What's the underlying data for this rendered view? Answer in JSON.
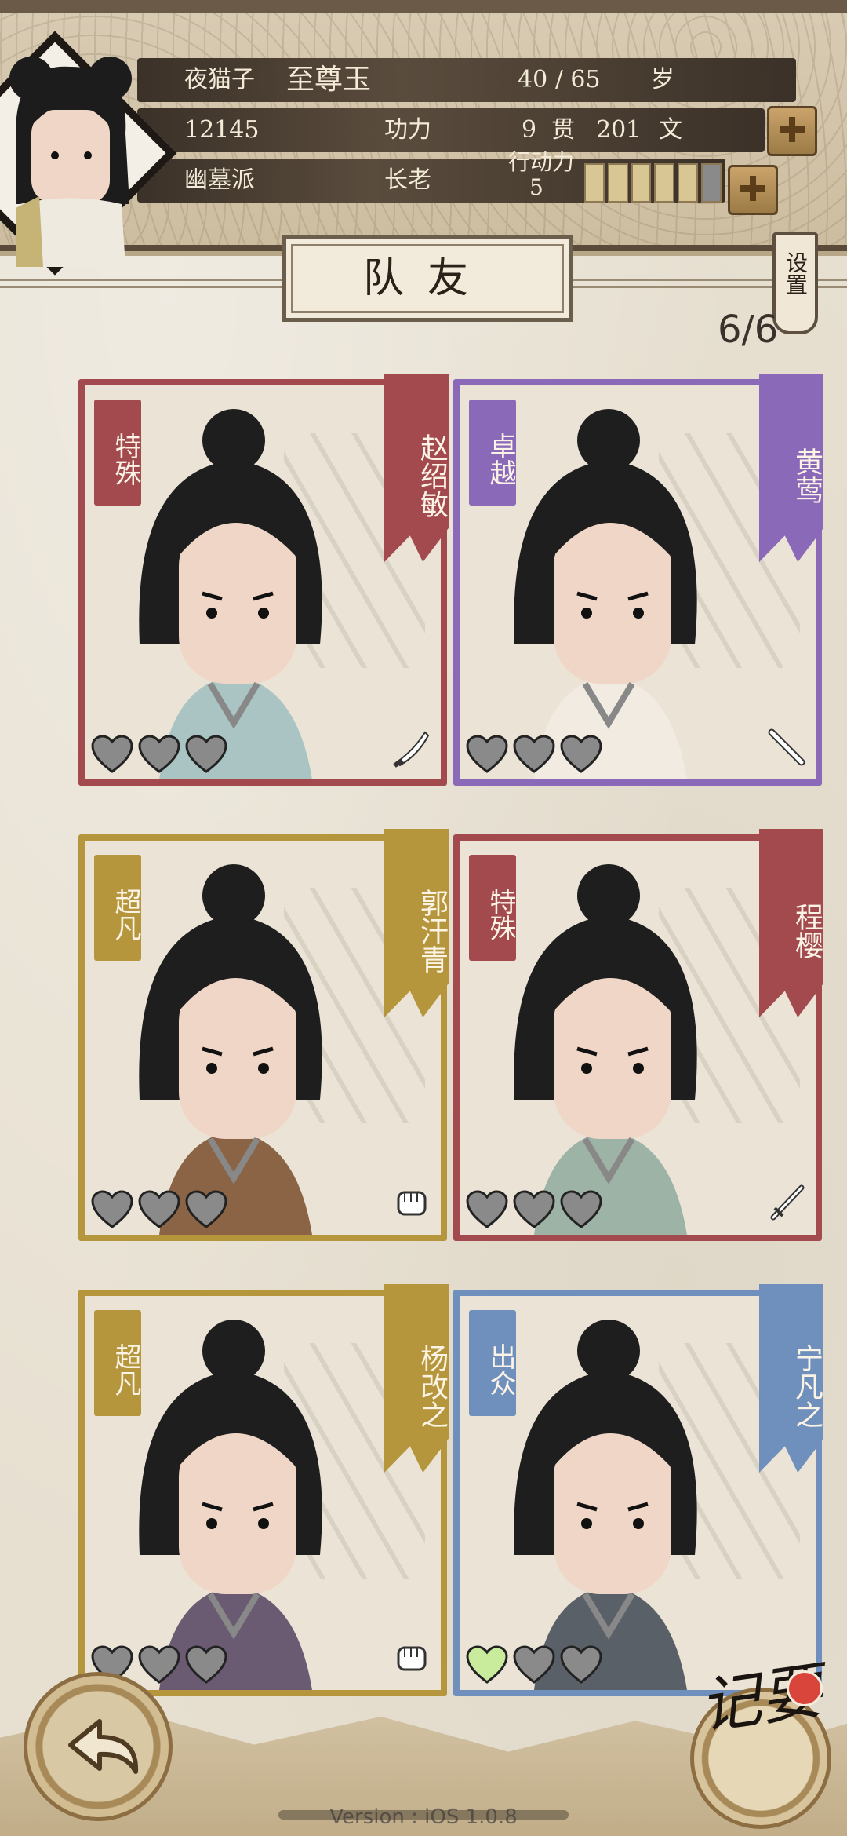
{
  "player": {
    "title": "夜猫子",
    "name": "至尊玉",
    "age": "40 / 65",
    "age_unit": "岁",
    "power_value": "12145",
    "power_label": "功力",
    "money_guan": "9",
    "money_guan_unit": "贯",
    "money_wen": "201",
    "money_wen_unit": "文",
    "sect": "幽墓派",
    "rank": "长老",
    "action_label": "行动力",
    "action_value": "5",
    "stamina_segments_filled": 5,
    "stamina_segments_total": 6
  },
  "header": {
    "title": "队友",
    "settings_label": "设置",
    "team_count": "6/6"
  },
  "colors": {
    "special": "#a24a4e",
    "excellent_gold": "#b6963c",
    "zhuoyue_purple": "#8a6ab8",
    "chuzhong_blue": "#6f90bd",
    "heart_empty": "#8a8a8a",
    "heart_full": "#c9ec9c"
  },
  "teammates": [
    {
      "name": "赵绍敏",
      "rank": "特殊",
      "color": "#a24a4e",
      "hearts_filled": 0,
      "weapon_icon": "saber-icon"
    },
    {
      "name": "黄莺",
      "rank": "卓越",
      "color": "#8a6ab8",
      "hearts_filled": 0,
      "weapon_icon": "flute-icon"
    },
    {
      "name": "郭汗青",
      "rank": "超凡",
      "color": "#b6963c",
      "hearts_filled": 0,
      "weapon_icon": "fist-icon"
    },
    {
      "name": "程樱",
      "rank": "特殊",
      "color": "#a24a4e",
      "hearts_filled": 0,
      "weapon_icon": "sword-icon"
    },
    {
      "name": "杨改之",
      "rank": "超凡",
      "color": "#b6963c",
      "hearts_filled": 0,
      "weapon_icon": "fist-icon"
    },
    {
      "name": "宁凡之",
      "rank": "出众",
      "color": "#6f90bd",
      "hearts_filled": 1,
      "weapon_icon": "none"
    }
  ],
  "bottom": {
    "notes_label": "记要",
    "version": "Version : iOS 1.0.8"
  }
}
